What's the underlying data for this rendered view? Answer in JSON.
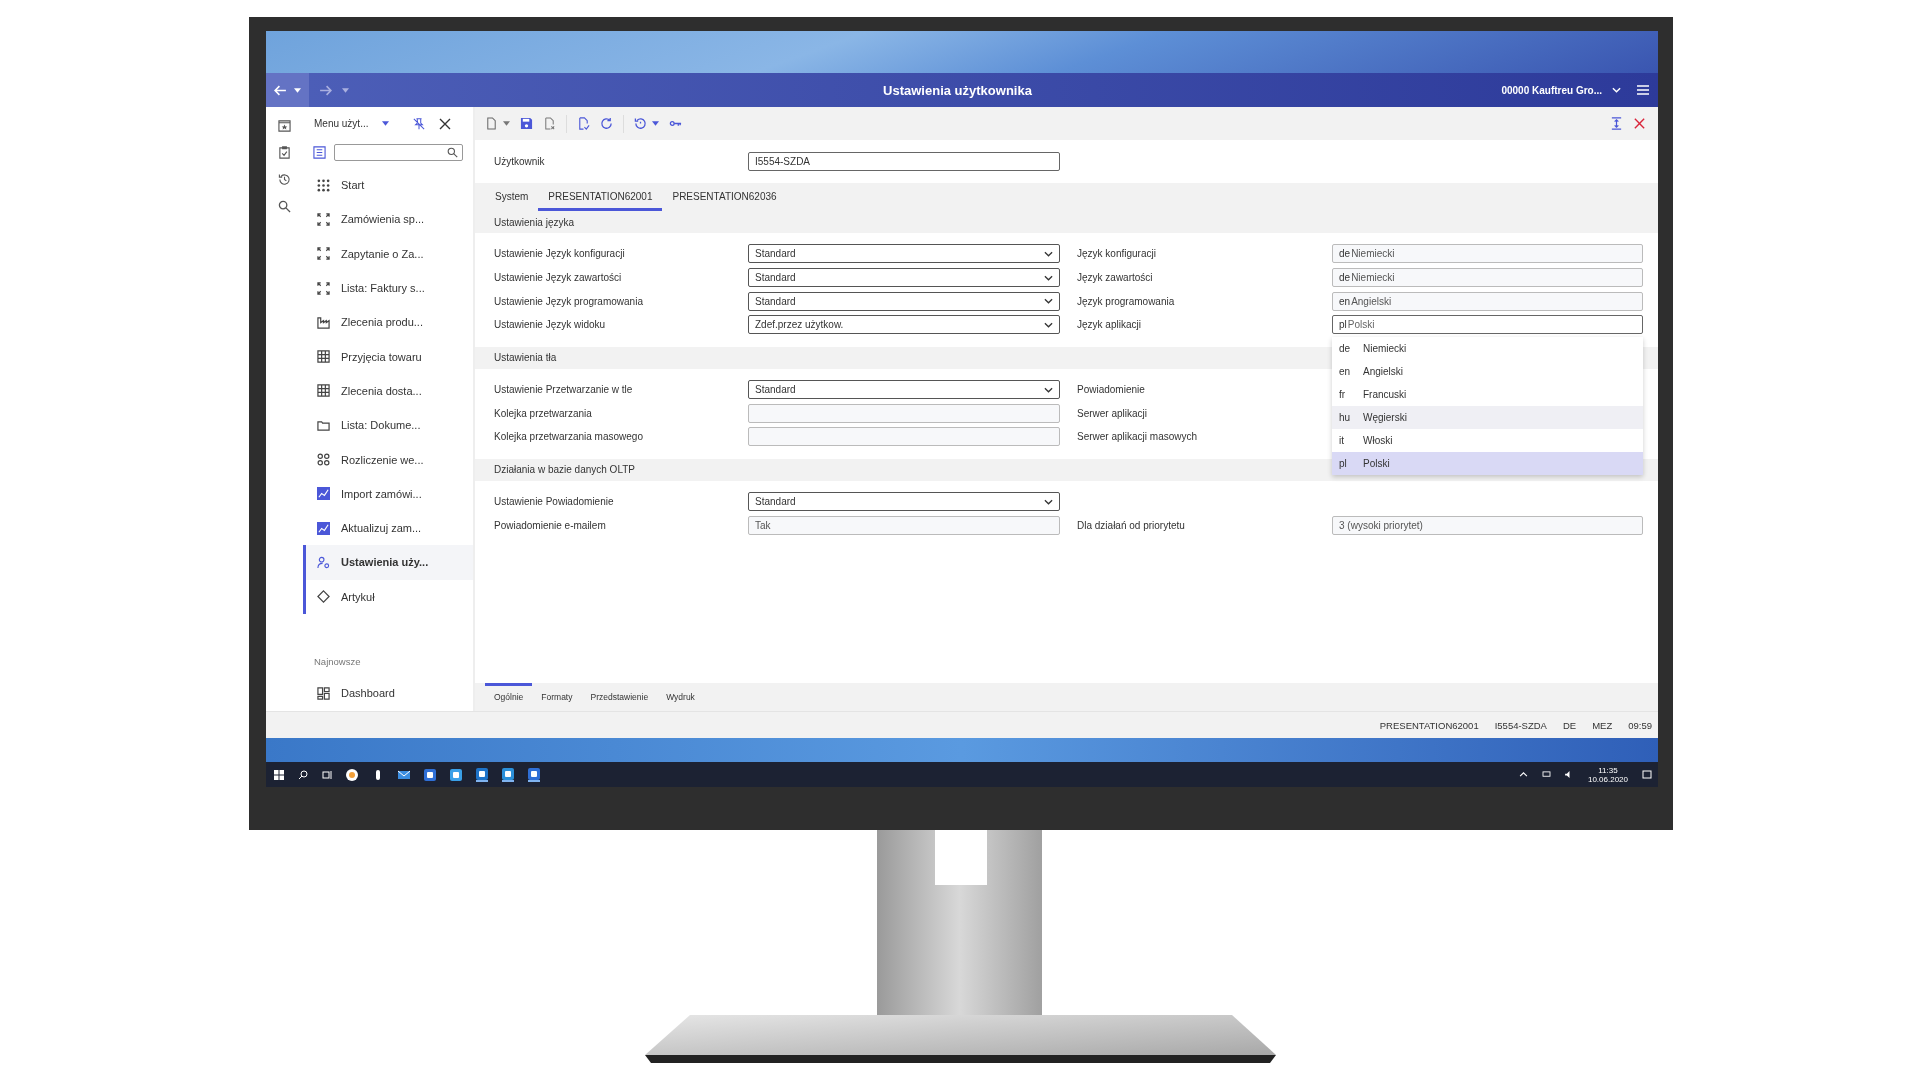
{
  "header": {
    "title": "Ustawienia użytkownika",
    "company": "00000  Kauftreu Gro..."
  },
  "sidebar": {
    "title": "Menu użyt...",
    "items": [
      {
        "label": "Start",
        "selected": false,
        "open": false
      },
      {
        "label": "Zamówienia sp...",
        "selected": false,
        "open": false
      },
      {
        "label": "Zapytanie o Za...",
        "selected": false,
        "open": false
      },
      {
        "label": "Lista: Faktury s...",
        "selected": false,
        "open": false
      },
      {
        "label": "Zlecenia produ...",
        "selected": false,
        "open": false
      },
      {
        "label": "Przyjęcia towaru",
        "selected": false,
        "open": false
      },
      {
        "label": "Zlecenia dosta...",
        "selected": false,
        "open": false
      },
      {
        "label": "Lista: Dokume...",
        "selected": false,
        "open": false
      },
      {
        "label": "Rozliczenie we...",
        "selected": false,
        "open": false
      },
      {
        "label": "Import zamówi...",
        "selected": false,
        "open": false
      },
      {
        "label": "Aktualizuj zam...",
        "selected": false,
        "open": false
      },
      {
        "label": "Ustawienia uży...",
        "selected": true,
        "open": true
      },
      {
        "label": "Artykuł",
        "selected": false,
        "open": true
      }
    ],
    "recent_heading": "Najnowsze",
    "recent_items": [
      {
        "label": "Dashboard"
      }
    ]
  },
  "form": {
    "user_label": "Użytkownik",
    "user_value": "I5554-SZDA",
    "tabs": [
      {
        "label": "System",
        "selected": false
      },
      {
        "label": "PRESENTATION62001",
        "selected": true
      },
      {
        "label": "PRESENTATION62036",
        "selected": false
      }
    ],
    "sections": [
      {
        "title": "Ustawienia języka",
        "rows": [
          {
            "left": {
              "label": "Ustawienie Język konfiguracji",
              "kind": "select",
              "value": "Standard"
            },
            "right": {
              "label": "Język konfiguracji",
              "kind": "readonly",
              "code": "de",
              "value": "Niemiecki"
            }
          },
          {
            "left": {
              "label": "Ustawienie Język zawartości",
              "kind": "select",
              "value": "Standard"
            },
            "right": {
              "label": "Język zawartości",
              "kind": "readonly",
              "code": "de",
              "value": "Niemiecki"
            }
          },
          {
            "left": {
              "label": "Ustawienie Język programowania",
              "kind": "select",
              "value": "Standard"
            },
            "right": {
              "label": "Język programowania",
              "kind": "readonly",
              "code": "en",
              "value": "Angielski"
            }
          },
          {
            "left": {
              "label": "Ustawienie Język widoku",
              "kind": "select",
              "value": "Zdef.przez użytkow."
            },
            "right": {
              "label": "Język aplikacji",
              "kind": "focused",
              "code": "pl",
              "value": "Polski"
            }
          }
        ]
      },
      {
        "title": "Ustawienia tła",
        "rows": [
          {
            "left": {
              "label": "Ustawienie Przetwarzanie w tle",
              "kind": "select",
              "value": "Standard"
            },
            "right": {
              "label": "Powiadomienie",
              "kind": "covered"
            }
          },
          {
            "left": {
              "label": "Kolejka przetwarzania",
              "kind": "readonly"
            },
            "right": {
              "label": "Serwer aplikacji",
              "kind": "covered"
            }
          },
          {
            "left": {
              "label": "Kolejka przetwarzania masowego",
              "kind": "readonly"
            },
            "right": {
              "label": "Serwer aplikacji masowych",
              "kind": "covered"
            }
          }
        ]
      },
      {
        "title": "Działania w bazie danych OLTP",
        "rows": [
          {
            "left": {
              "label": "Ustawienie Powiadomienie",
              "kind": "select",
              "value": "Standard"
            }
          },
          {
            "left": {
              "label": "Powiadomienie e-mailem",
              "kind": "readonly",
              "value": "Tak"
            },
            "right": {
              "label": "Dla działań od priorytetu",
              "kind": "readonly",
              "value": "3 (wysoki priorytet)"
            }
          }
        ]
      }
    ],
    "dropdown": [
      {
        "code": "de",
        "label": "Niemiecki",
        "selected": false,
        "hovered": false
      },
      {
        "code": "en",
        "label": "Angielski",
        "selected": false,
        "hovered": false
      },
      {
        "code": "fr",
        "label": "Francuski",
        "selected": false,
        "hovered": false
      },
      {
        "code": "hu",
        "label": "Węgierski",
        "selected": false,
        "hovered": true
      },
      {
        "code": "it",
        "label": "Włoski",
        "selected": false,
        "hovered": false
      },
      {
        "code": "pl",
        "label": "Polski",
        "selected": true,
        "hovered": false
      }
    ],
    "bottom_tabs": [
      {
        "label": "Ogólnie",
        "selected": true
      },
      {
        "label": "Formaty",
        "selected": false
      },
      {
        "label": "Przedstawienie",
        "selected": false
      },
      {
        "label": "Wydruk",
        "selected": false
      }
    ]
  },
  "status_bar": [
    "PRESENTATION62001",
    "I5554-SZDA",
    "DE",
    "MEZ",
    "09:59"
  ],
  "taskbar": {
    "time": "11:35",
    "date": "10.06.2020"
  }
}
